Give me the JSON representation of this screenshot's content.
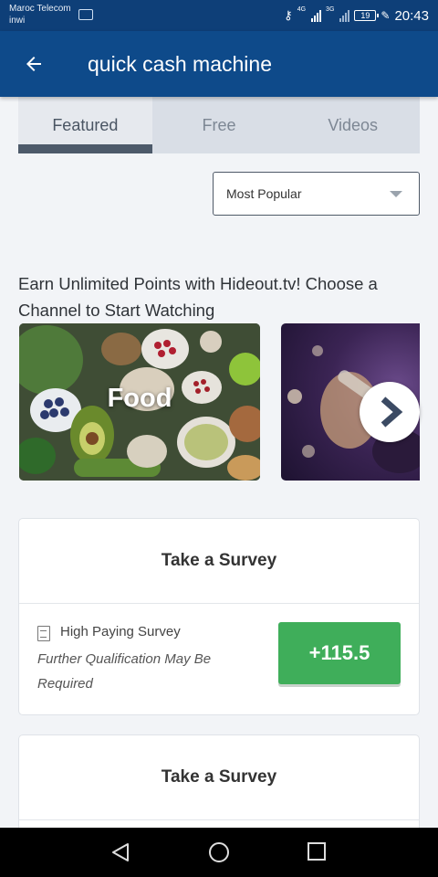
{
  "status_bar": {
    "carrier_1": "Maroc Telecom",
    "carrier_2": "inwi",
    "net_1": "4G",
    "net_2": "3G",
    "battery": "19",
    "time": "20:43"
  },
  "app_bar": {
    "back_icon": "arrow-left-icon",
    "title": "quick cash machine"
  },
  "tabs": [
    {
      "label": "Featured",
      "active": true
    },
    {
      "label": "Free",
      "active": false
    },
    {
      "label": "Videos",
      "active": false
    }
  ],
  "sort": {
    "selected": "Most Popular"
  },
  "promo": {
    "text": "Earn Unlimited Points with Hideout.tv! Choose a Channel to Start Watching"
  },
  "channels": [
    {
      "label": "Food"
    },
    {
      "label": ""
    }
  ],
  "surveys": [
    {
      "header": "Take a Survey",
      "title": "High Paying Survey",
      "note": "Further Qualification May Be Required",
      "points": "+115.5"
    },
    {
      "header": "Take a Survey"
    }
  ],
  "colors": {
    "app_bar": "#0e4a8a",
    "status_bar": "#0e3f78",
    "points_button": "#3fae5a",
    "tab_indicator": "#4d5a6a"
  }
}
